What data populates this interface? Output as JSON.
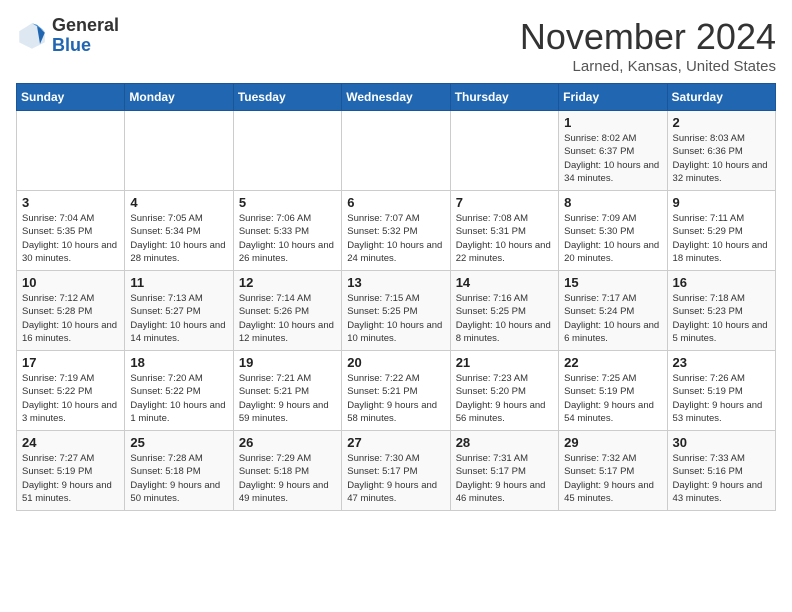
{
  "header": {
    "logo_general": "General",
    "logo_blue": "Blue",
    "month_title": "November 2024",
    "location": "Larned, Kansas, United States"
  },
  "weekdays": [
    "Sunday",
    "Monday",
    "Tuesday",
    "Wednesday",
    "Thursday",
    "Friday",
    "Saturday"
  ],
  "weeks": [
    [
      {
        "day": "",
        "info": ""
      },
      {
        "day": "",
        "info": ""
      },
      {
        "day": "",
        "info": ""
      },
      {
        "day": "",
        "info": ""
      },
      {
        "day": "",
        "info": ""
      },
      {
        "day": "1",
        "info": "Sunrise: 8:02 AM\nSunset: 6:37 PM\nDaylight: 10 hours and 34 minutes."
      },
      {
        "day": "2",
        "info": "Sunrise: 8:03 AM\nSunset: 6:36 PM\nDaylight: 10 hours and 32 minutes."
      }
    ],
    [
      {
        "day": "3",
        "info": "Sunrise: 7:04 AM\nSunset: 5:35 PM\nDaylight: 10 hours and 30 minutes."
      },
      {
        "day": "4",
        "info": "Sunrise: 7:05 AM\nSunset: 5:34 PM\nDaylight: 10 hours and 28 minutes."
      },
      {
        "day": "5",
        "info": "Sunrise: 7:06 AM\nSunset: 5:33 PM\nDaylight: 10 hours and 26 minutes."
      },
      {
        "day": "6",
        "info": "Sunrise: 7:07 AM\nSunset: 5:32 PM\nDaylight: 10 hours and 24 minutes."
      },
      {
        "day": "7",
        "info": "Sunrise: 7:08 AM\nSunset: 5:31 PM\nDaylight: 10 hours and 22 minutes."
      },
      {
        "day": "8",
        "info": "Sunrise: 7:09 AM\nSunset: 5:30 PM\nDaylight: 10 hours and 20 minutes."
      },
      {
        "day": "9",
        "info": "Sunrise: 7:11 AM\nSunset: 5:29 PM\nDaylight: 10 hours and 18 minutes."
      }
    ],
    [
      {
        "day": "10",
        "info": "Sunrise: 7:12 AM\nSunset: 5:28 PM\nDaylight: 10 hours and 16 minutes."
      },
      {
        "day": "11",
        "info": "Sunrise: 7:13 AM\nSunset: 5:27 PM\nDaylight: 10 hours and 14 minutes."
      },
      {
        "day": "12",
        "info": "Sunrise: 7:14 AM\nSunset: 5:26 PM\nDaylight: 10 hours and 12 minutes."
      },
      {
        "day": "13",
        "info": "Sunrise: 7:15 AM\nSunset: 5:25 PM\nDaylight: 10 hours and 10 minutes."
      },
      {
        "day": "14",
        "info": "Sunrise: 7:16 AM\nSunset: 5:25 PM\nDaylight: 10 hours and 8 minutes."
      },
      {
        "day": "15",
        "info": "Sunrise: 7:17 AM\nSunset: 5:24 PM\nDaylight: 10 hours and 6 minutes."
      },
      {
        "day": "16",
        "info": "Sunrise: 7:18 AM\nSunset: 5:23 PM\nDaylight: 10 hours and 5 minutes."
      }
    ],
    [
      {
        "day": "17",
        "info": "Sunrise: 7:19 AM\nSunset: 5:22 PM\nDaylight: 10 hours and 3 minutes."
      },
      {
        "day": "18",
        "info": "Sunrise: 7:20 AM\nSunset: 5:22 PM\nDaylight: 10 hours and 1 minute."
      },
      {
        "day": "19",
        "info": "Sunrise: 7:21 AM\nSunset: 5:21 PM\nDaylight: 9 hours and 59 minutes."
      },
      {
        "day": "20",
        "info": "Sunrise: 7:22 AM\nSunset: 5:21 PM\nDaylight: 9 hours and 58 minutes."
      },
      {
        "day": "21",
        "info": "Sunrise: 7:23 AM\nSunset: 5:20 PM\nDaylight: 9 hours and 56 minutes."
      },
      {
        "day": "22",
        "info": "Sunrise: 7:25 AM\nSunset: 5:19 PM\nDaylight: 9 hours and 54 minutes."
      },
      {
        "day": "23",
        "info": "Sunrise: 7:26 AM\nSunset: 5:19 PM\nDaylight: 9 hours and 53 minutes."
      }
    ],
    [
      {
        "day": "24",
        "info": "Sunrise: 7:27 AM\nSunset: 5:19 PM\nDaylight: 9 hours and 51 minutes."
      },
      {
        "day": "25",
        "info": "Sunrise: 7:28 AM\nSunset: 5:18 PM\nDaylight: 9 hours and 50 minutes."
      },
      {
        "day": "26",
        "info": "Sunrise: 7:29 AM\nSunset: 5:18 PM\nDaylight: 9 hours and 49 minutes."
      },
      {
        "day": "27",
        "info": "Sunrise: 7:30 AM\nSunset: 5:17 PM\nDaylight: 9 hours and 47 minutes."
      },
      {
        "day": "28",
        "info": "Sunrise: 7:31 AM\nSunset: 5:17 PM\nDaylight: 9 hours and 46 minutes."
      },
      {
        "day": "29",
        "info": "Sunrise: 7:32 AM\nSunset: 5:17 PM\nDaylight: 9 hours and 45 minutes."
      },
      {
        "day": "30",
        "info": "Sunrise: 7:33 AM\nSunset: 5:16 PM\nDaylight: 9 hours and 43 minutes."
      }
    ]
  ]
}
